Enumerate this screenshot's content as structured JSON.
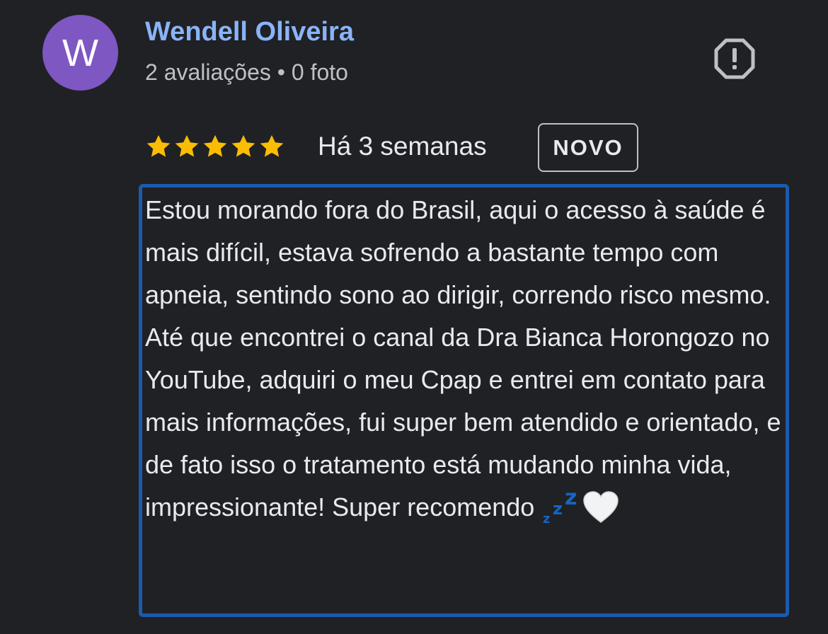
{
  "reviewer": {
    "initial": "W",
    "avatar_color": "#7e57c2",
    "name": "Wendell Oliveira",
    "meta": "2 avaliações • 0 foto"
  },
  "report_icon": "report-flag-icon",
  "review": {
    "rating": 5,
    "max_rating": 5,
    "date": "Há 3 semanas",
    "badge": "NOVO",
    "text": "Estou morando fora do Brasil, aqui o acesso à saúde é mais difícil, estava sofrendo a bastante tempo com apneia, sentindo sono ao dirigir, correndo risco mesmo. Até que encontrei o canal da Dra Bianca Horongozo no YouTube, adquiri o meu Cpap e entrei em contato para mais informações, fui super bem atendido e orientado, e de fato isso o tratamento está mudando minha vida, impressionante! Super recomendo",
    "emojis": [
      "zzz-emoji-icon",
      "white-heart-emoji-icon"
    ]
  },
  "colors": {
    "background": "#202124",
    "name_link": "#8ab4f8",
    "star": "#fbbc04",
    "highlight_border": "#1a5bad"
  }
}
